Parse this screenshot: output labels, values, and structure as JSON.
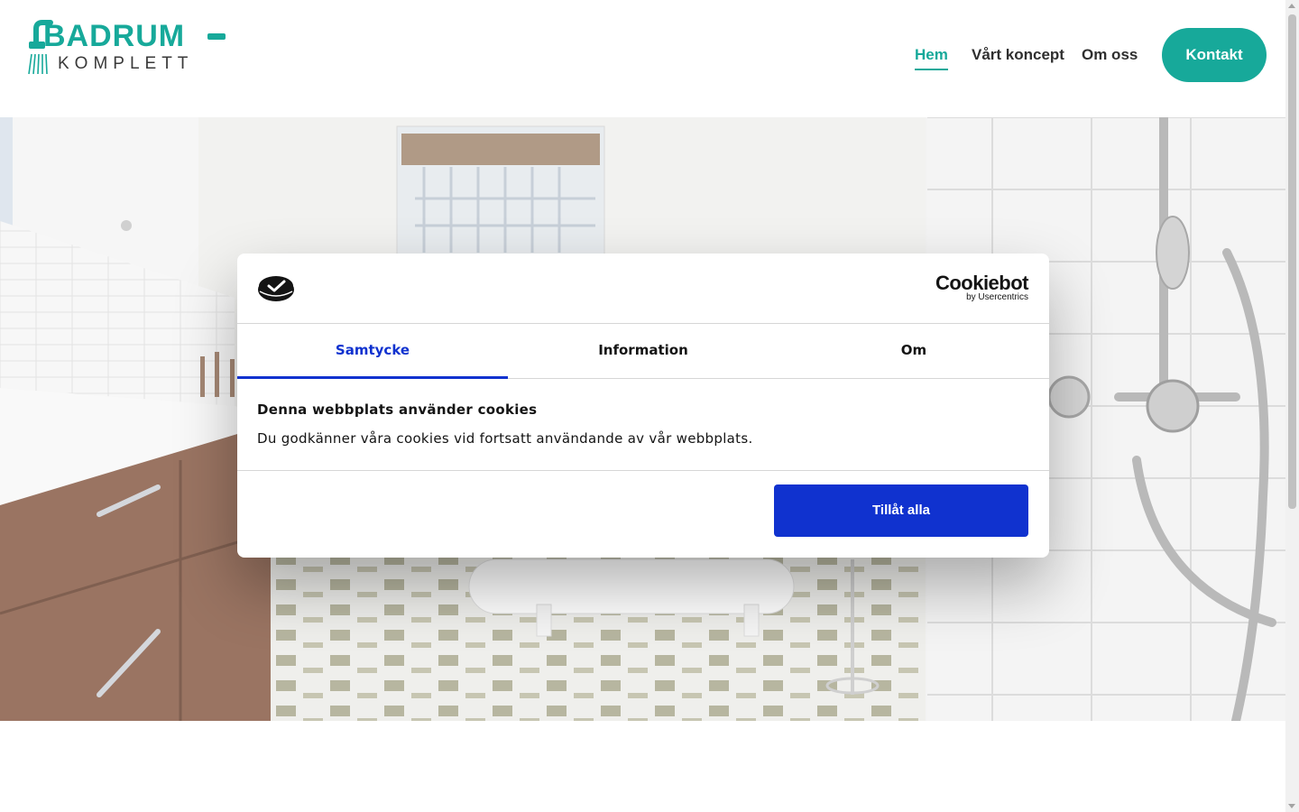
{
  "header": {
    "logo": {
      "line1": "BADRUM",
      "line2": "KOMPLETT"
    },
    "nav": [
      {
        "label": "Hem",
        "active": true
      },
      {
        "label": "Vårt koncept",
        "active": false
      },
      {
        "label": "Om oss",
        "active": false
      }
    ],
    "cta_label": "Kontakt"
  },
  "colors": {
    "brand_teal": "#17a99a",
    "cookie_blue": "#1032cf",
    "text_dark": "#141414"
  },
  "hero": {
    "image": "bathroom-photo"
  },
  "cookie_dialog": {
    "brand": {
      "name": "Cookiebot",
      "by": "by Usercentrics"
    },
    "tabs": [
      {
        "label": "Samtycke",
        "active": true
      },
      {
        "label": "Information",
        "active": false
      },
      {
        "label": "Om",
        "active": false
      }
    ],
    "title": "Denna webbplats använder cookies",
    "text": "Du godkänner våra cookies vid fortsatt användande av vår webbplats.",
    "allow_label": "Tillåt alla"
  },
  "icons": [
    "shower-logo-icon",
    "cookiebot-logo-icon",
    "scroll-up-icon",
    "scroll-down-icon"
  ]
}
